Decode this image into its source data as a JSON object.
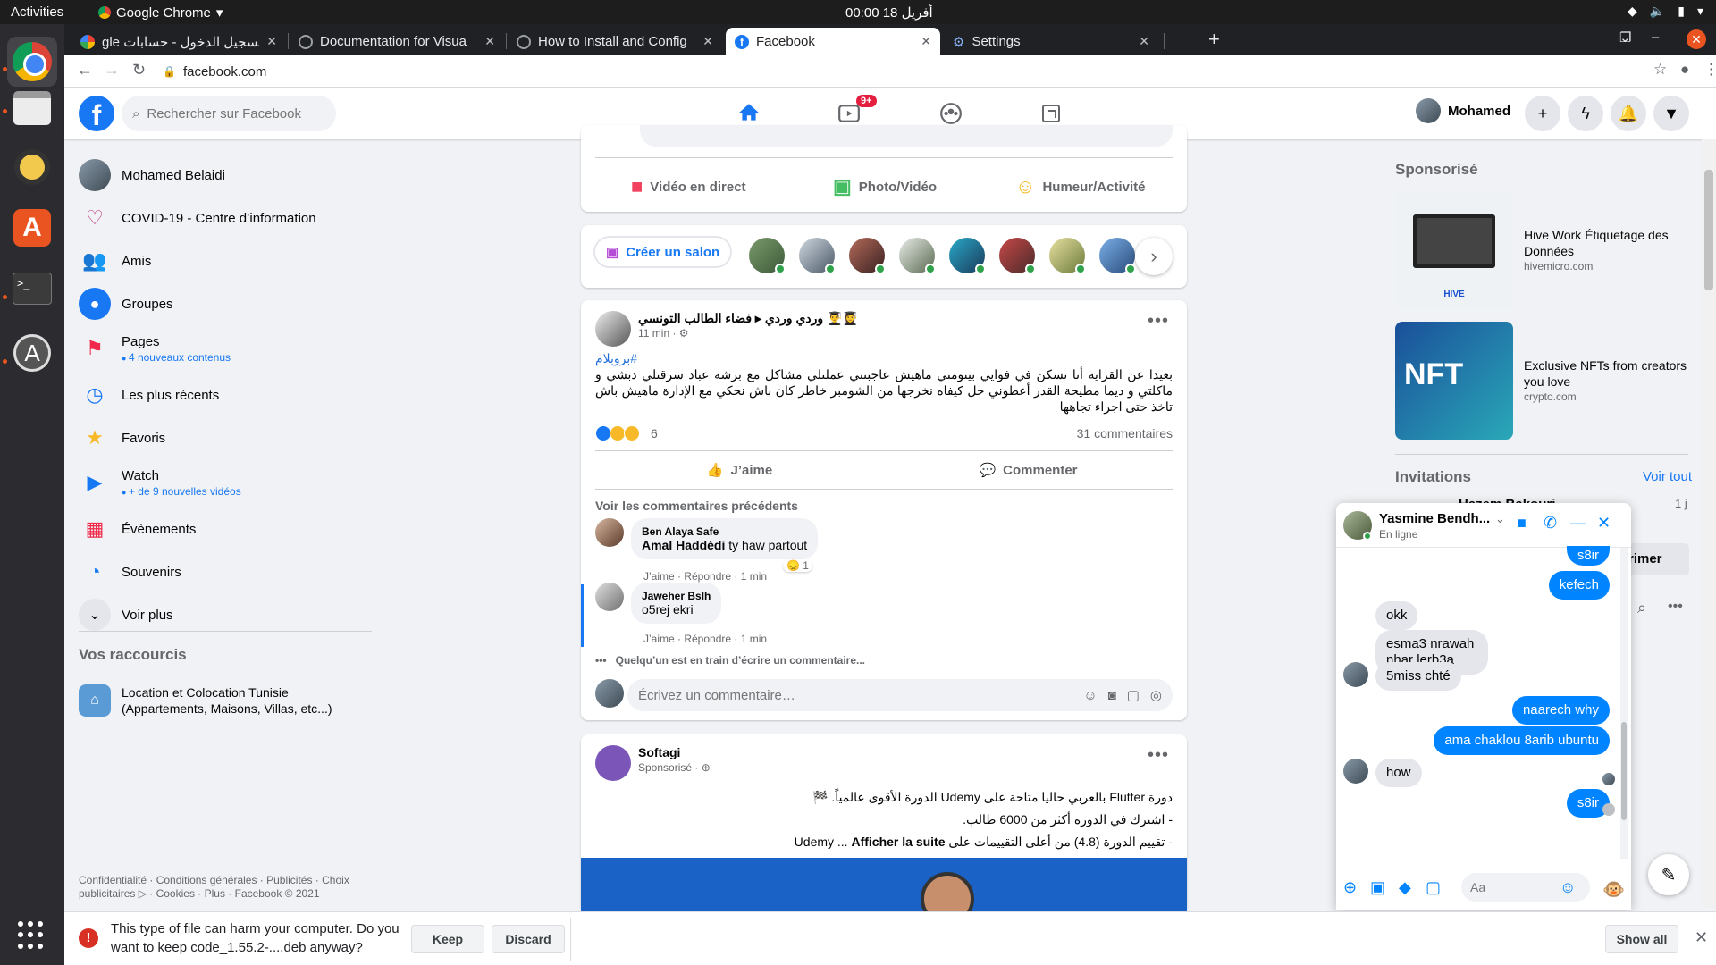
{
  "system": {
    "activities": "Activities",
    "app_name": "Google Chrome",
    "clock": "00:00  أفريل 18"
  },
  "browser": {
    "tabs": [
      {
        "title": "gle تسجيل الدخول - حسابات",
        "favicon": "google-icon"
      },
      {
        "title": "Documentation for Visua",
        "favicon": "globe-icon"
      },
      {
        "title": "How to Install and Config",
        "favicon": "globe-icon"
      },
      {
        "title": "Facebook",
        "favicon": "facebook-icon",
        "active": true
      },
      {
        "title": "Settings",
        "favicon": "gear-icon"
      }
    ],
    "url": "facebook.com"
  },
  "fb": {
    "search_placeholder": "Rechercher sur Facebook",
    "watch_badge": "9+",
    "profile_name": "Mohamed",
    "accent": "#1877f2"
  },
  "leftnav": {
    "items": [
      {
        "label": "Mohamed Belaidi"
      },
      {
        "label": "COVID-19 - Centre d’information"
      },
      {
        "label": "Amis"
      },
      {
        "label": "Groupes"
      },
      {
        "label": "Pages",
        "sub": "4 nouveaux contenus"
      },
      {
        "label": "Les plus récents"
      },
      {
        "label": "Favoris"
      },
      {
        "label": "Watch",
        "sub": "+ de 9 nouvelles vidéos"
      },
      {
        "label": "Évènements"
      },
      {
        "label": "Souvenirs"
      },
      {
        "label": "Voir plus"
      }
    ],
    "shortcuts_title": "Vos raccourcis",
    "shortcut": "Location et Colocation Tunisie (Appartements, Maisons, Villas, etc...)",
    "footer": "Confidentialité · Conditions générales · Publicités · Choix publicitaires ▷ · Cookies · Plus · Facebook © 2021"
  },
  "composer": {
    "live": "Vidéo en direct",
    "photo": "Photo/Vidéo",
    "mood": "Humeur/Activité",
    "create_room": "Créer un salon"
  },
  "post": {
    "author": "وردي وردي ▸ فضاء الطالب التونسي 👨‍🎓👩‍🎓",
    "time": "11 min · ⚙",
    "hashtag": "#بروبلام",
    "text": "بعيدا عن القراية أنا نسكن في فوايي بينومتي ماهيش عاجبتني عملتلي مشاكل مع برشة عباد سرقتلي دبشي و ماكلتي و ديما مطيحة القدر أعطوني حل كيفاه نخرجها من الشومبر خاطر كان باش نحكي مع الإدارة ماهيش باش تاخذ حتى اجراء تجاهها",
    "reaction_count": "6",
    "comments_count": "31 commentaires",
    "like": "J’aime",
    "comment": "Commenter",
    "prev_comments": "Voir les commentaires précédents",
    "comments": [
      {
        "name": "Ben Alaya Safe",
        "mention": "Amal Haddédi",
        "text": "ty haw partout",
        "actions": "J’aime · Répondre · 1 min",
        "react_count": "1"
      },
      {
        "name": "Jaweher Bslh",
        "text": "o5rej ekri",
        "actions": "J’aime · Répondre · 1 min"
      }
    ],
    "typing": "Quelqu’un est en train d’écrire un commentaire...",
    "input_placeholder": "Écrivez un commentaire…"
  },
  "ad_post": {
    "author": "Softagi",
    "meta": "Sponsorisé · ⊕",
    "lines": [
      "دورة Flutter بالعربي حاليا متاحة على Udemy الدورة الأقوى عالمياً. 🏁",
      "- اشترك في الدورة أكثر من 6000 طالب.",
      "- تقييم الدورة (4.8) من أعلى التقييمات على Udemy ..."
    ],
    "see_more": "Afficher la suite"
  },
  "right": {
    "sponsored_title": "Sponsorisé",
    "ads": [
      {
        "title": "Hive Work Étiquetage des Données",
        "url": "hivemicro.com",
        "img_text": "HIVE"
      },
      {
        "title": "Exclusive NFTs from creators you love",
        "url": "crypto.com",
        "img_text": "NFT"
      }
    ],
    "invitations": "Invitations",
    "see_all": "Voir tout",
    "invite_name": "Hazem Bakouri",
    "invite_time": "1 j",
    "confirm_partial": "rimer"
  },
  "chat": {
    "name": "Yasmine Bendh...",
    "status": "En ligne",
    "messages": [
      {
        "from": "me",
        "text": "s8ir"
      },
      {
        "from": "me",
        "text": "kefech"
      },
      {
        "from": "them",
        "text": "okk"
      },
      {
        "from": "them",
        "text": "esma3 nrawah nhar lerb3a"
      },
      {
        "from": "them",
        "text": "5miss chté"
      },
      {
        "from": "me",
        "text": "naarech why"
      },
      {
        "from": "me",
        "text": "ama chaklou 8arib ubuntu"
      },
      {
        "from": "them",
        "text": "how"
      },
      {
        "from": "me",
        "text": "s8ir"
      }
    ],
    "input_placeholder": "Aa"
  },
  "download": {
    "warning": "This type of file can harm your computer. Do you want to keep code_1.55.2-....deb anyway?",
    "keep": "Keep",
    "discard": "Discard",
    "show_all": "Show all"
  }
}
